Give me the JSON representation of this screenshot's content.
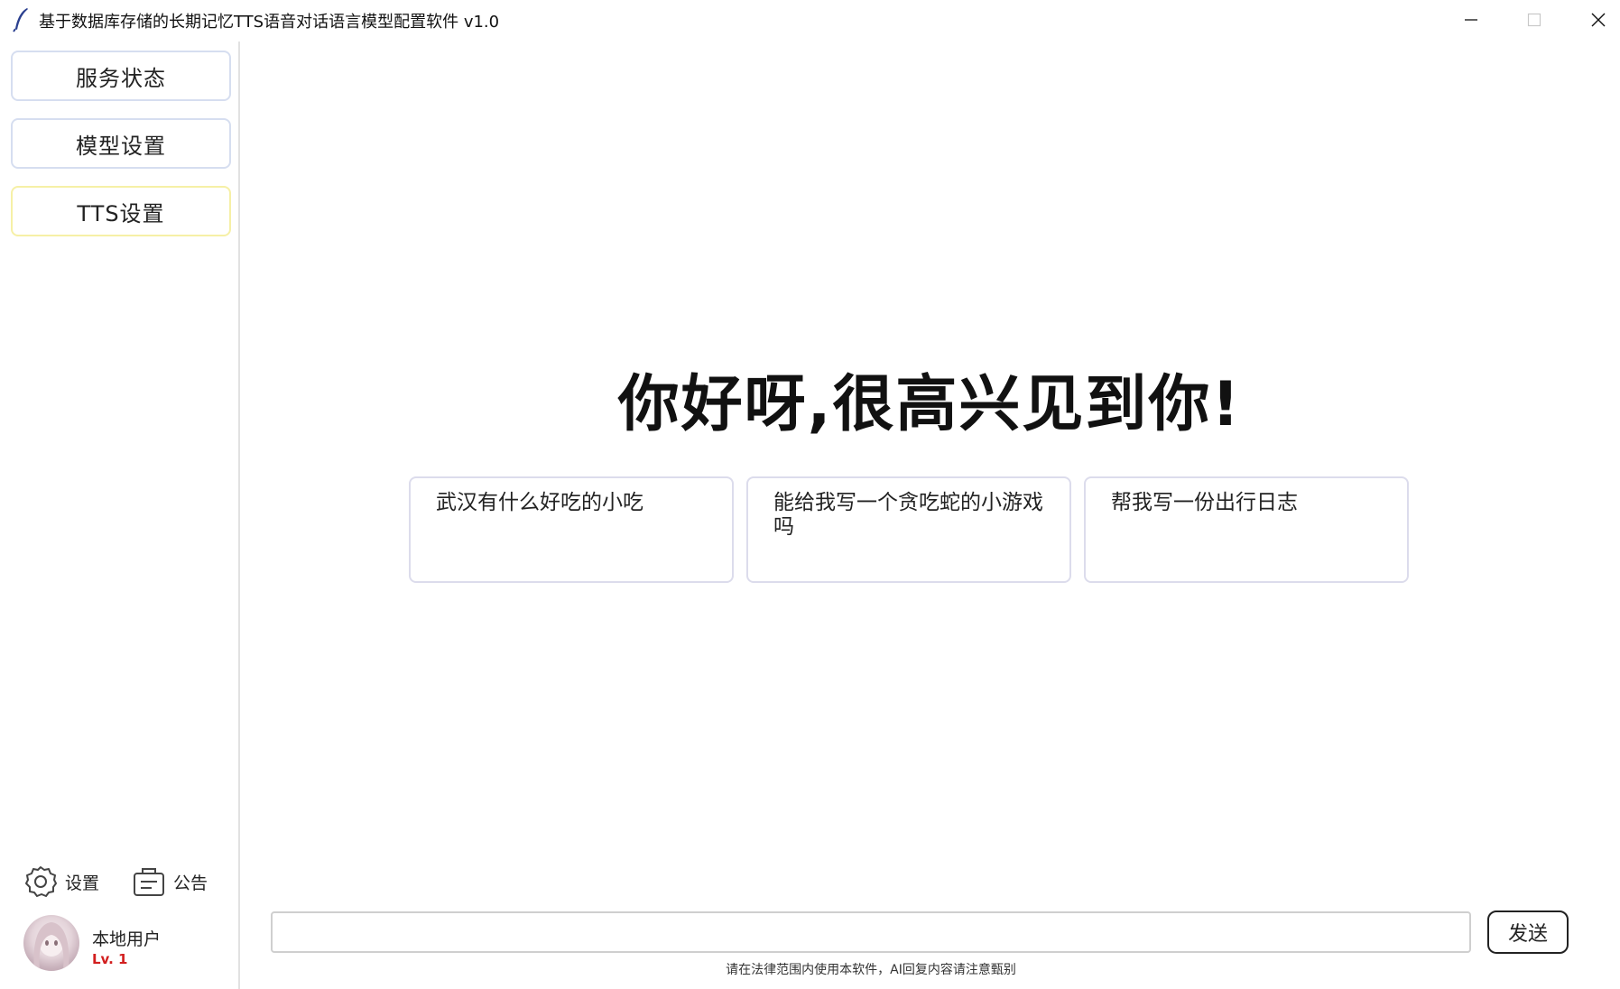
{
  "window": {
    "title": "基于数据库存储的长期记忆TTS语音对话语言模型配置软件 v1.0",
    "app_icon": "feather-icon",
    "controls": [
      "minimize-icon",
      "maximize-icon",
      "close-icon"
    ]
  },
  "sidebar": {
    "nav": [
      {
        "label": "服务状态"
      },
      {
        "label": "模型设置"
      },
      {
        "label": "TTS设置"
      }
    ],
    "tools": {
      "settings_label": "设置",
      "settings_icon": "gear-icon",
      "notice_label": "公告",
      "notice_icon": "announcement-icon"
    },
    "user": {
      "name": "本地用户",
      "level": "Lv. 1"
    }
  },
  "main": {
    "greeting": "你好呀,很高兴见到你!",
    "suggestions": [
      "武汉有什么好吃的小吃",
      "能给我写一个贪吃蛇的小游戏吗",
      "帮我写一份出行日志"
    ],
    "input_value": "",
    "send_label": "发送",
    "disclaimer": "请在法律范围内使用本软件，AI回复内容请注意甄别"
  },
  "colors": {
    "nav_border": "#d6def0",
    "nav_active_border": "#f6f0a6",
    "level_color": "#d21f1f"
  }
}
